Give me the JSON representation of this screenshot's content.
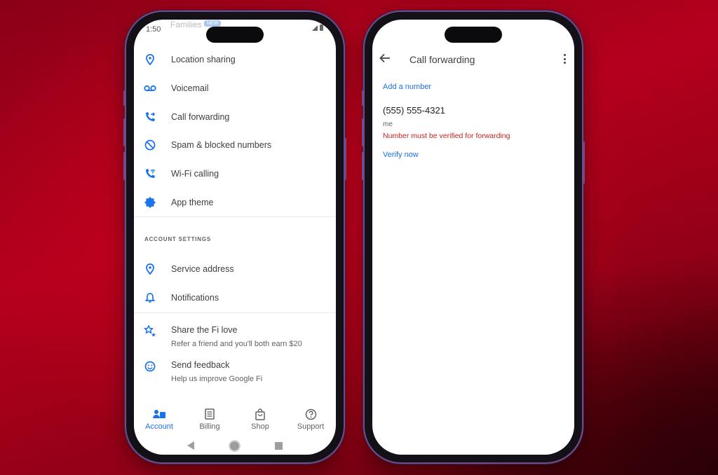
{
  "colors": {
    "accent": "#1a73e8",
    "error": "#c5221f",
    "text_primary": "#3c4043",
    "text_secondary": "#5f6368",
    "background": "#b4001e"
  },
  "left_phone": {
    "status_bar": {
      "time": "1:50",
      "faded_header": "Families",
      "faded_badge": "NEW",
      "icons": [
        "signal-icon",
        "battery-icon"
      ]
    },
    "menu_items": [
      {
        "label": "Location sharing",
        "icon": "location-pin-icon"
      },
      {
        "label": "Voicemail",
        "icon": "voicemail-icon"
      },
      {
        "label": "Call forwarding",
        "icon": "call-forward-icon"
      },
      {
        "label": "Spam & blocked numbers",
        "icon": "block-icon"
      },
      {
        "label": "Wi-Fi calling",
        "icon": "wifi-calling-icon"
      },
      {
        "label": "App theme",
        "icon": "theme-icon"
      }
    ],
    "account_settings": {
      "header": "ACCOUNT SETTINGS",
      "items": [
        {
          "label": "Service address",
          "icon": "location-pin-icon"
        },
        {
          "label": "Notifications",
          "icon": "bell-icon"
        }
      ]
    },
    "extras": [
      {
        "label": "Share the Fi love",
        "sub": "Refer a friend and you'll both earn $20",
        "icon": "stars-icon"
      },
      {
        "label": "Send feedback",
        "sub": "Help us improve Google Fi",
        "icon": "smiley-icon"
      }
    ],
    "bottom_nav": [
      {
        "label": "Account",
        "icon": "account-icon",
        "active": true
      },
      {
        "label": "Billing",
        "icon": "billing-icon",
        "active": false
      },
      {
        "label": "Shop",
        "icon": "shop-bag-icon",
        "active": false
      },
      {
        "label": "Support",
        "icon": "help-icon",
        "active": false
      }
    ],
    "system_nav": [
      "back-triangle-icon",
      "home-circle-icon",
      "recents-square-icon"
    ]
  },
  "right_phone": {
    "appbar": {
      "title": "Call forwarding",
      "back_icon": "arrow-back-icon",
      "more_icon": "more-vert-icon"
    },
    "add_number_label": "Add a number",
    "forward_number": {
      "number": "(555) 555-4321",
      "owner": "me",
      "error": "Number must be verified for forwarding",
      "action": "Verify now"
    }
  }
}
